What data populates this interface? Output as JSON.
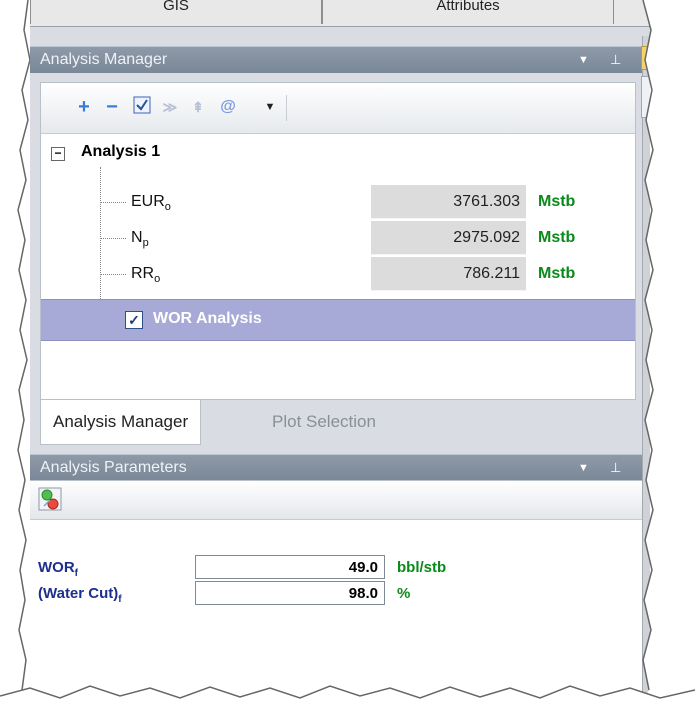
{
  "top_tabs": [
    "GIS",
    "Attributes"
  ],
  "analysis_manager": {
    "title": "Analysis Manager",
    "toolbar_icons": [
      "add-icon",
      "remove-icon",
      "check-icon",
      "expand-down-icon",
      "collapse-up-icon",
      "at-icon",
      "dropdown-arrow-icon"
    ],
    "tree": {
      "root_label": "Analysis 1",
      "expander": "−",
      "properties": [
        {
          "base": "EUR",
          "sub": "o",
          "value": "3761.303",
          "unit": "Mstb"
        },
        {
          "base": "N",
          "sub": "p",
          "value": "2975.092",
          "unit": "Mstb"
        },
        {
          "base": "RR",
          "sub": "o",
          "value": "786.211",
          "unit": "Mstb"
        }
      ],
      "child_analysis": {
        "label": "WOR Analysis",
        "checked": true
      }
    },
    "tabs": {
      "active": "Analysis Manager",
      "inactive": "Plot Selection"
    }
  },
  "analysis_parameters": {
    "title": "Analysis Parameters",
    "params": [
      {
        "base": "WOR",
        "sub": "f",
        "value": "49.0",
        "unit": "bbl/stb"
      },
      {
        "base": "(Water Cut)",
        "sub": "f",
        "value": "98.0",
        "unit": "%"
      }
    ]
  },
  "colors": {
    "header": "#8493a3",
    "selection": "#a7a9d6",
    "unit_green": "#0a8a1a",
    "param_blue": "#1c2f8c"
  }
}
